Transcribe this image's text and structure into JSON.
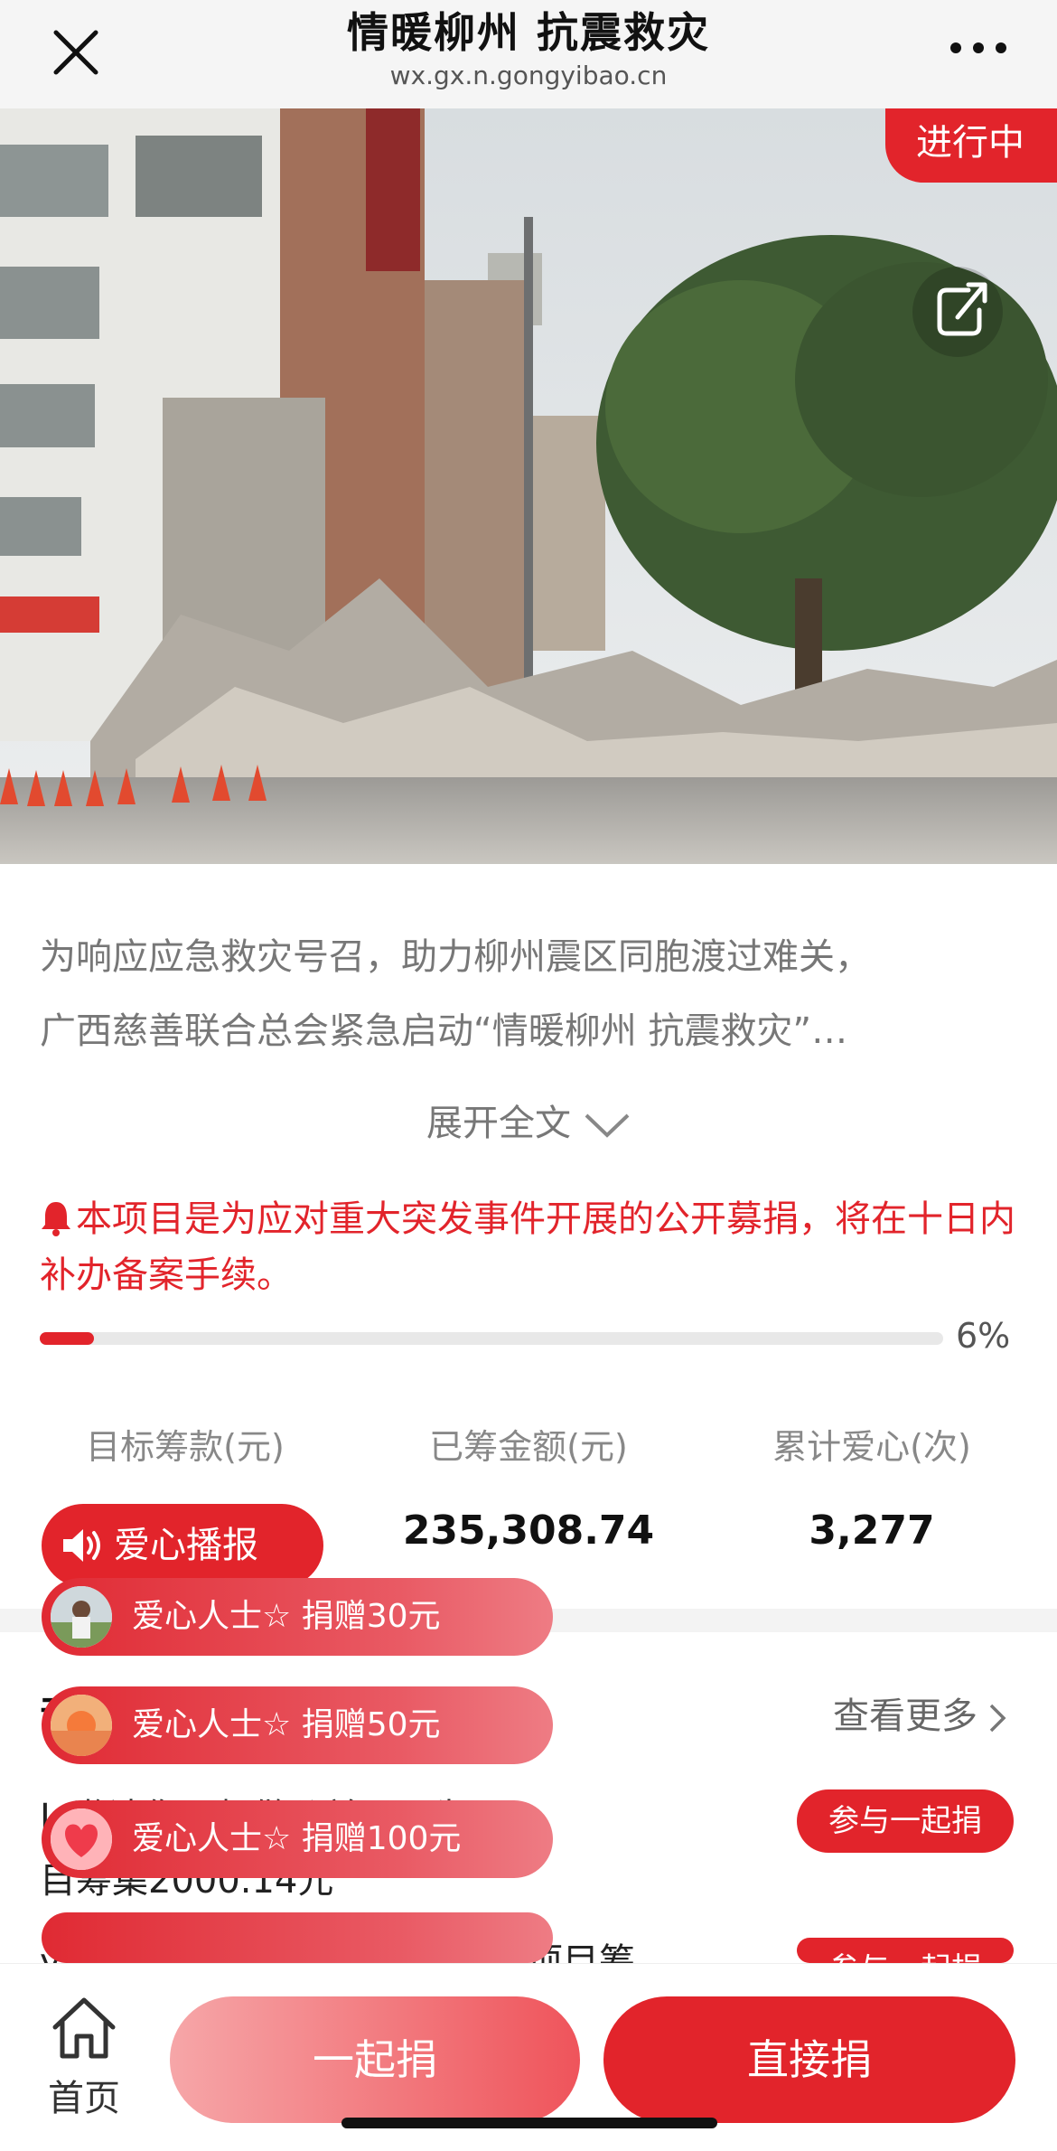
{
  "topbar": {
    "title": "情暖柳州 抗震救灾",
    "domain": "wx.gx.n.gongyibao.cn"
  },
  "hero": {
    "status": "进行中"
  },
  "intro": {
    "line1": "为响应应急救灾号召，助力柳州震区同胞渡过难关，",
    "line2": "广西慈善联合总会紧急启动“情暖柳州 抗震救灾”…",
    "expand_label": "展开全文"
  },
  "notice": "本项目是为应对重大突发事件开展的公开募捐，将在十日内补办备案手续。",
  "progress": {
    "percent_label": "6%",
    "fraction": 0.06
  },
  "stats": [
    {
      "label": "目标筹款(元)",
      "value": ""
    },
    {
      "label": "已筹金额(元)",
      "value": "235,308.74"
    },
    {
      "label": "累计爱心(次)",
      "value": "3,277"
    }
  ],
  "broadcast": {
    "label": "爱心播报"
  },
  "section": {
    "title_partial": "动",
    "more_label": "查看更多"
  },
  "donations": [
    {
      "text": "爱心人士☆ 捐赠30元"
    },
    {
      "text": "爱心人士☆ 捐赠50元"
    },
    {
      "text": "爱心人士☆ 捐赠100元"
    }
  ],
  "list": [
    {
      "line1": "L                    邀请你一起做公益，已为项",
      "line2": "目筹集2000.14元",
      "button": "参与一起捐"
    },
    {
      "line1": "yang邀请你一起做公益，已为项目筹",
      "button": "参与一起捐"
    }
  ],
  "bottom": {
    "home_label": "首页",
    "together_label": "一起捐",
    "direct_label": "直接捐"
  },
  "colors": {
    "accent": "#e2242b",
    "notice": "#e2242b"
  }
}
